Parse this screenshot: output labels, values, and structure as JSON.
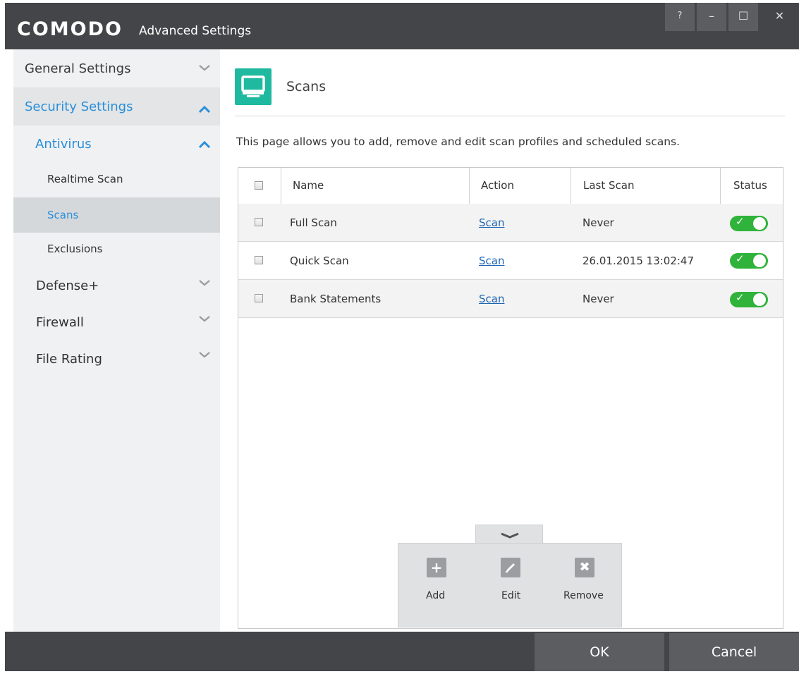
{
  "titlebar": {
    "brand": "COMODO",
    "subtitle": "Advanced Settings",
    "help": "?",
    "minimize": "–",
    "maximize": "☐",
    "close": "✕"
  },
  "sidebar": {
    "items": [
      {
        "label": "General Settings",
        "icon": "chevron-down-icon"
      },
      {
        "label": "Security Settings",
        "icon": "chevron-up-icon"
      },
      {
        "label": "Antivirus",
        "icon": "chevron-up-icon"
      },
      {
        "label": "Realtime Scan"
      },
      {
        "label": "Scans"
      },
      {
        "label": "Exclusions"
      },
      {
        "label": "Defense+",
        "icon": "chevron-down-icon"
      },
      {
        "label": "Firewall",
        "icon": "chevron-down-icon"
      },
      {
        "label": "File Rating",
        "icon": "chevron-down-icon"
      }
    ]
  },
  "main": {
    "title": "Scans",
    "description": "This page allows you to add, remove and edit scan profiles and scheduled scans.",
    "table": {
      "headers": {
        "name": "Name",
        "action": "Action",
        "last_scan": "Last Scan",
        "status": "Status"
      },
      "rows": [
        {
          "name": "Full Scan",
          "action": "Scan",
          "last_scan": "Never",
          "status": "on"
        },
        {
          "name": "Quick Scan",
          "action": "Scan",
          "last_scan": "26.01.2015 13:02:47",
          "status": "on"
        },
        {
          "name": "Bank Statements",
          "action": "Scan",
          "last_scan": "Never",
          "status": "on"
        }
      ]
    },
    "actions": {
      "add": "Add",
      "edit": "Edit",
      "remove": "Remove"
    }
  },
  "footer": {
    "ok": "OK",
    "cancel": "Cancel"
  },
  "colors": {
    "titlebar": "#434548",
    "accent_blue": "#2a8fd9",
    "teal_icon": "#1fb99f",
    "toggle_on": "#2fb33a"
  }
}
